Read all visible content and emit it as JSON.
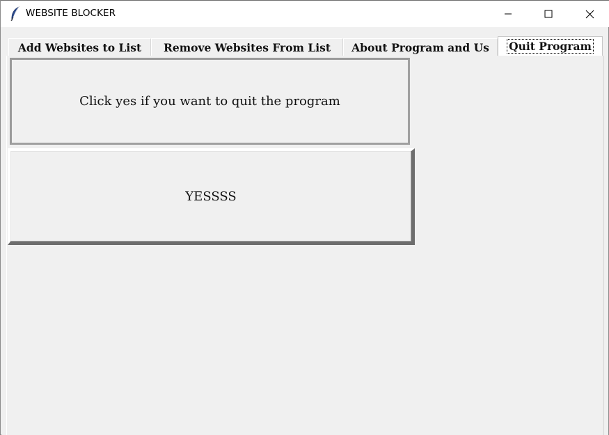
{
  "window": {
    "title": "WEBSITE BLOCKER",
    "app_icon": "feather-icon",
    "controls": {
      "minimize_icon": "minimize-icon",
      "maximize_icon": "maximize-icon",
      "close_icon": "close-icon"
    }
  },
  "tabs": [
    {
      "label": "Add Websites to List",
      "selected": false
    },
    {
      "label": "Remove Websites From List",
      "selected": false
    },
    {
      "label": "About Program and Us",
      "selected": false
    },
    {
      "label": "Quit Program",
      "selected": true
    }
  ],
  "quit_page": {
    "message": "Click yes if you want to quit the program",
    "yes_button_label": "YESSSS"
  },
  "colors": {
    "background": "#f0f0f0",
    "titlebar": "#ffffff",
    "text": "#111111"
  }
}
